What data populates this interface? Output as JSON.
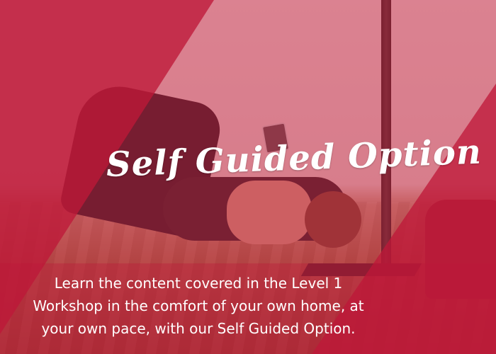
{
  "hero": {
    "title": "Self Guided Option",
    "description_lines": [
      "Learn the content covered in the Level 1",
      "Workshop in the comfort of your own home, at",
      "your own pace, with our Self Guided Option."
    ]
  },
  "colors": {
    "accent_red": "#be1838",
    "text": "#ffffff"
  }
}
